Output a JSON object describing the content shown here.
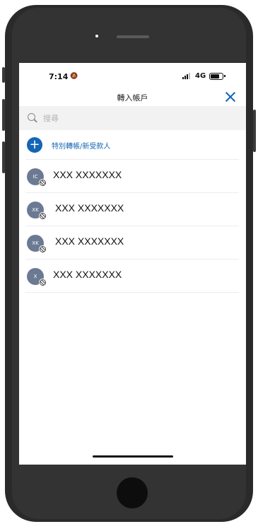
{
  "status_bar": {
    "time": "7:14",
    "network": "4G"
  },
  "header": {
    "title": "轉入帳戶"
  },
  "search": {
    "placeholder": "搜尋"
  },
  "add_item": {
    "label": "特別轉帳/新受款人"
  },
  "accounts": [
    {
      "initials": "IC",
      "name": "XXX XXXXXXX"
    },
    {
      "initials": "XK",
      "name": "XXX XXXXXXX"
    },
    {
      "initials": "XK",
      "name": "XXX XXXXXXX"
    },
    {
      "initials": "X",
      "name": "XXX XXXXXXX"
    }
  ],
  "colors": {
    "accent": "#1565b5",
    "avatar": "#6b7a92",
    "search_bg": "#f2f2f2"
  },
  "icons": [
    "bell-slash-icon",
    "signal-icon",
    "battery-icon",
    "close-icon",
    "search-icon",
    "plus-icon",
    "bank-badge-icon"
  ]
}
